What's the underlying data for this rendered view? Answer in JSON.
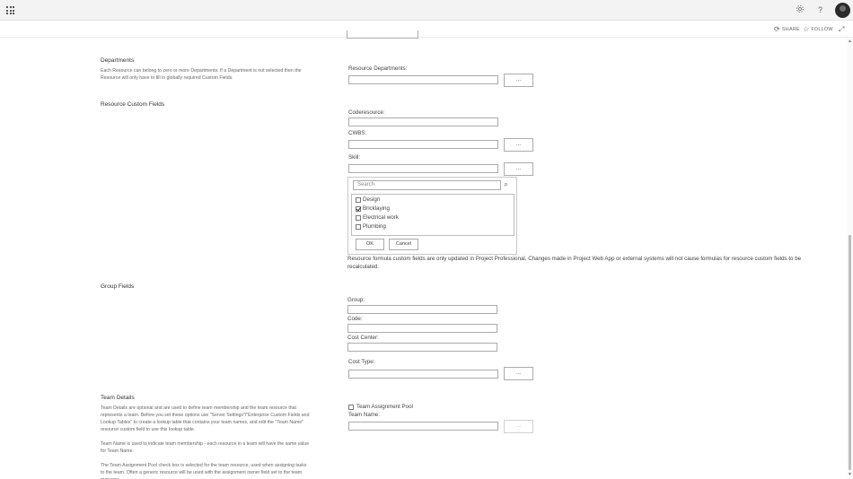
{
  "suitebar": {
    "settings_icon": "gear-icon",
    "help_label": "?",
    "avatar_icon": "user-avatar"
  },
  "actions": {
    "share": "SHARE",
    "follow": "FOLLOW",
    "focus_icon": "focus-mode-icon"
  },
  "departments": {
    "title": "Departments",
    "description": "Each Resource can belong to zero or more Departments. If a Department is not selected then the Resource will only have to fill in globally required Custom Fields.",
    "field_label": "Resource Departments:",
    "browse_label": "..."
  },
  "custom_fields": {
    "title": "Resource Custom Fields",
    "coderesource_label": "Coderesource:",
    "cwbs_label": "CWBS:",
    "skill_label": "Skill:",
    "browse_label": "...",
    "popup": {
      "search_placeholder": "Search",
      "options": [
        {
          "label": "Design",
          "checked": false
        },
        {
          "label": "Bricklaying",
          "checked": true
        },
        {
          "label": "Electrical work",
          "checked": false
        },
        {
          "label": "Plumbing",
          "checked": false
        }
      ],
      "ok_label": "OK",
      "cancel_label": "Cancel"
    },
    "note": "Resource formula custom fields are only updated in Project Professional. Changes made in Project Web App or external systems will not cause formulas for resource custom fields to be recalculated."
  },
  "group_fields": {
    "title": "Group Fields",
    "group_label": "Group:",
    "code_label": "Code:",
    "cost_center_label": "Cost Center:",
    "cost_type_label": "Cost Type:",
    "browse_label": "..."
  },
  "team_details": {
    "title": "Team Details",
    "paragraph1": "Team Details are optional and are used to define team membership and the team resource that represents a team. Before you set these options use \"Server Settings\"/\"Enterprise Custom Fields and Lookup Tables\" to create a lookup table that contains your team names, and edit the \"Team Name\" resource custom field to use this lookup table.",
    "paragraph2": "Team Name is used to indicate team membership - each resource in a team will have the same value for Team Name.",
    "paragraph3": "The Team Assignment Pool check box is selected for the team resource, used when assigning tasks to the team. Often a generic resource will be used with the assignment owner field set to the team manager.",
    "pool_label": "Team Assignment Pool",
    "pool_checked": false,
    "team_name_label": "Team Name:",
    "browse_label": "..."
  }
}
